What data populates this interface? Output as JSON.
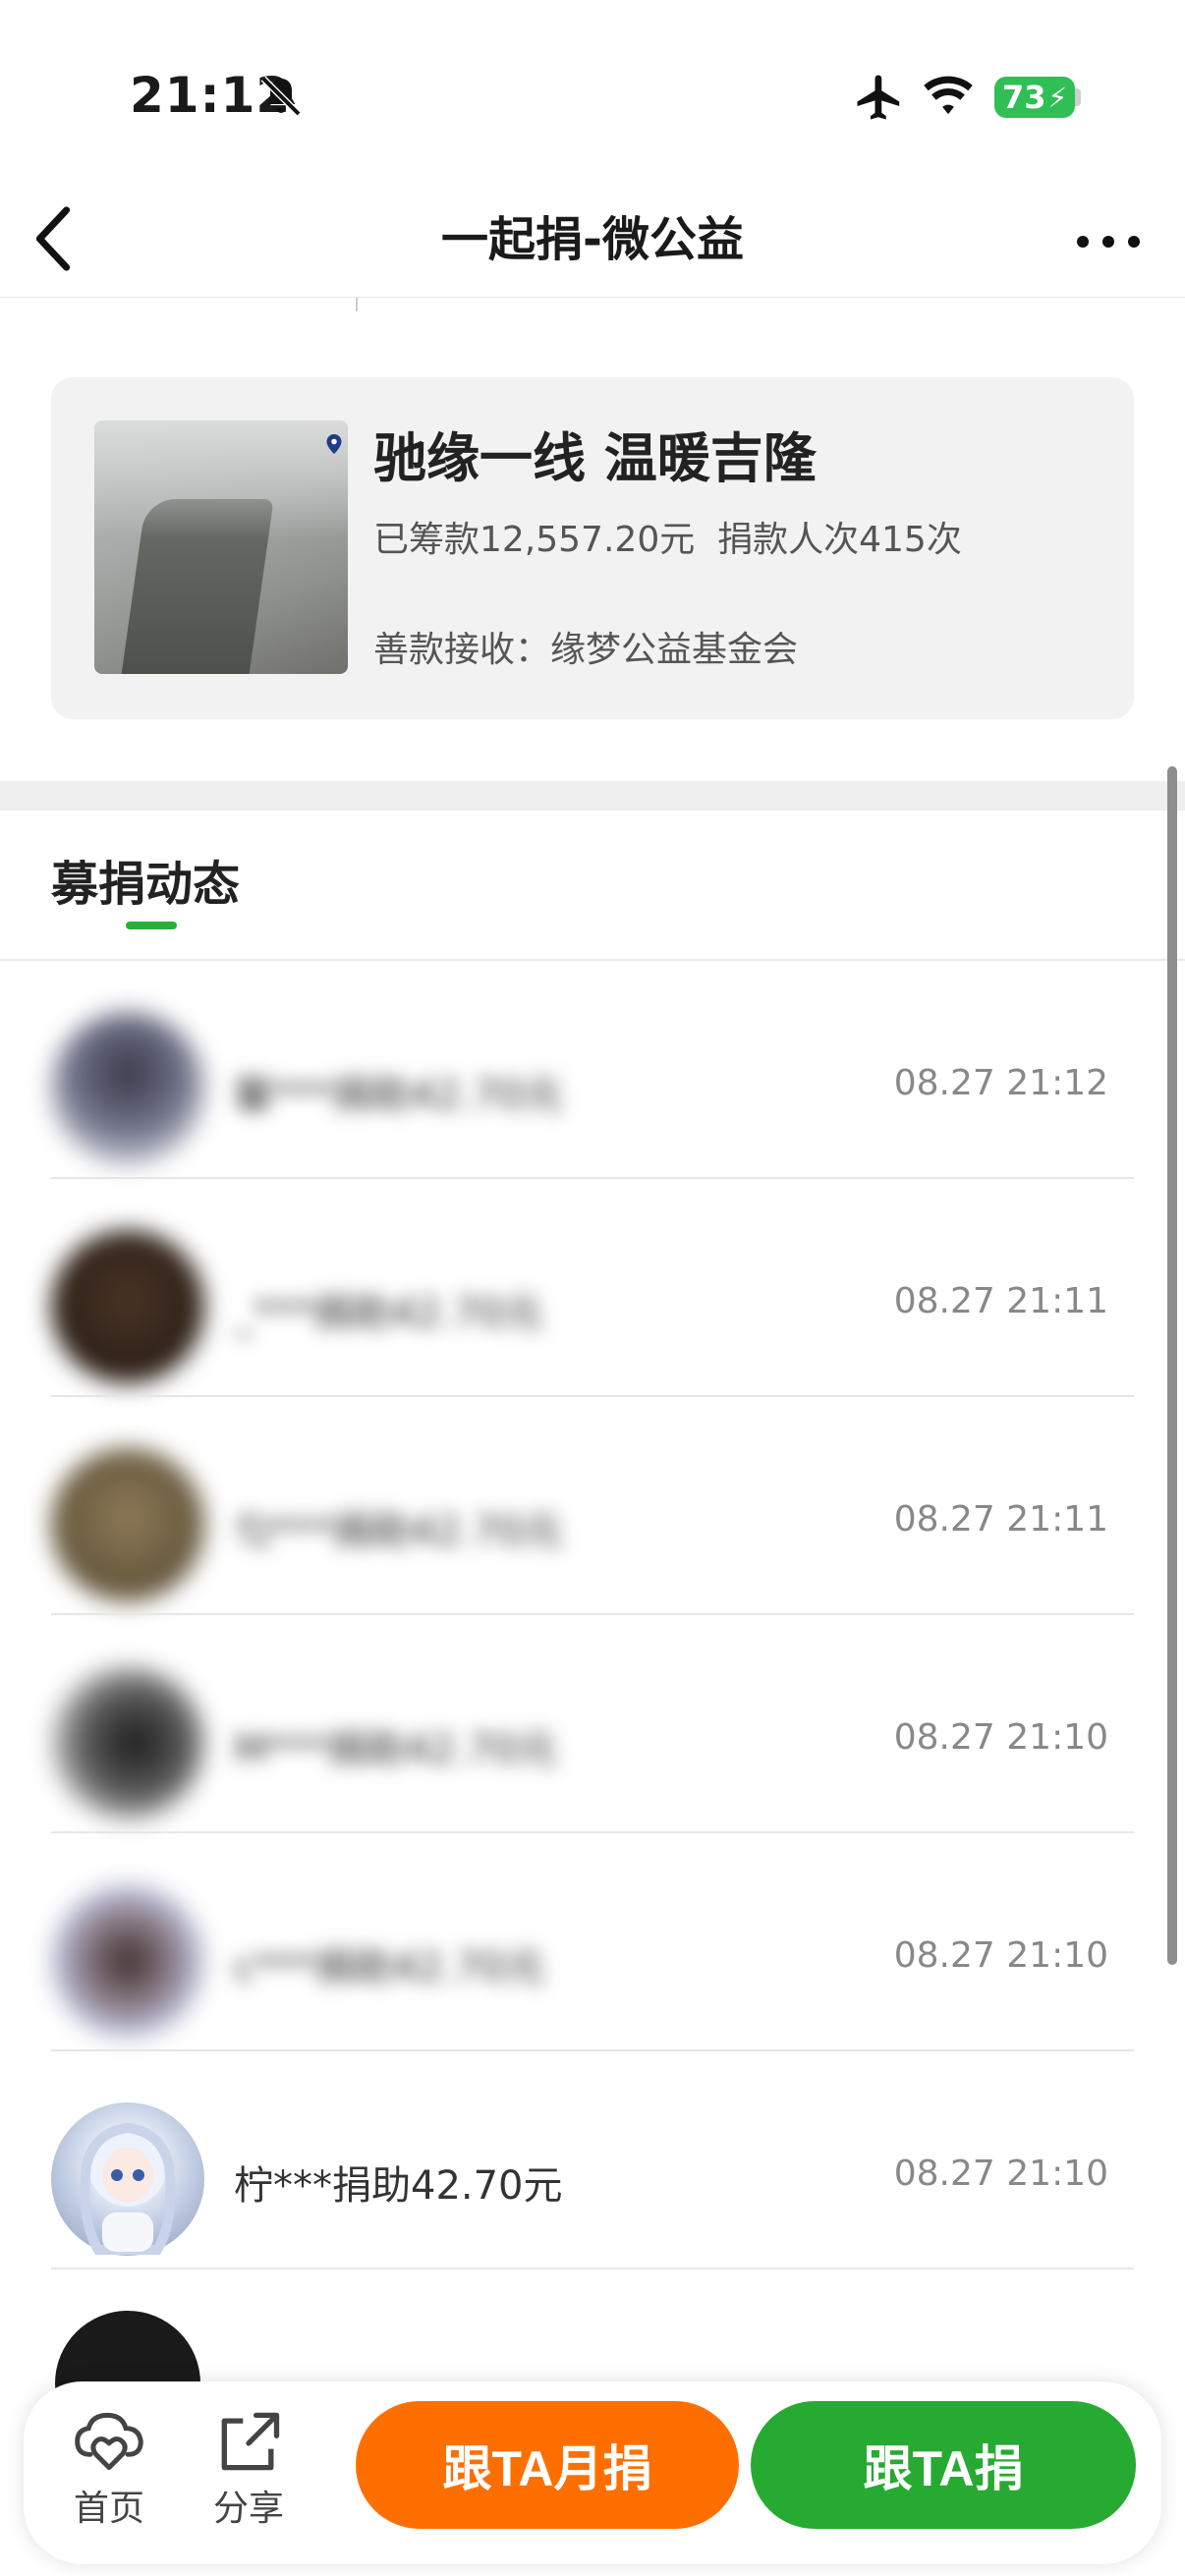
{
  "status_bar": {
    "time": "21:12",
    "battery": "73",
    "icons": [
      "bell-slash-icon",
      "airplane-icon",
      "wifi-icon",
      "battery-charging-icon"
    ]
  },
  "nav": {
    "title": "一起捐-微公益",
    "back_icon": "chevron-left-icon",
    "more_icon": "more-dots-icon"
  },
  "project": {
    "title": "驰缘一线 温暖吉隆",
    "raised": "已筹款12,557.20元",
    "donors": "捐款人次415次",
    "receiver_label": "善款接收：",
    "receiver": "缘梦公益基金会"
  },
  "tabs": {
    "active": "募捐动态"
  },
  "donations": [
    {
      "text": "馨***捐助42.70元",
      "time": "08.27 21:12",
      "blurred": true
    },
    {
      "text": "_***捐助42.70元",
      "time": "08.27 21:11",
      "blurred": true
    },
    {
      "text": "匀***捐助42.70元",
      "time": "08.27 21:11",
      "blurred": true
    },
    {
      "text": "M***捐助42.70元",
      "time": "08.27 21:10",
      "blurred": true
    },
    {
      "text": "c***捐助42.70元",
      "time": "08.27 21:10",
      "blurred": true
    },
    {
      "text": "柠***捐助42.70元",
      "time": "08.27 21:10",
      "blurred": false
    }
  ],
  "bottom_bar": {
    "home_label": "首页",
    "share_label": "分享",
    "monthly_button": "跟TA月捐",
    "donate_button": "跟TA捐"
  },
  "colors": {
    "accent_green": "#27aa32",
    "accent_orange": "#ff6f00",
    "battery_green": "#2fbf55"
  }
}
